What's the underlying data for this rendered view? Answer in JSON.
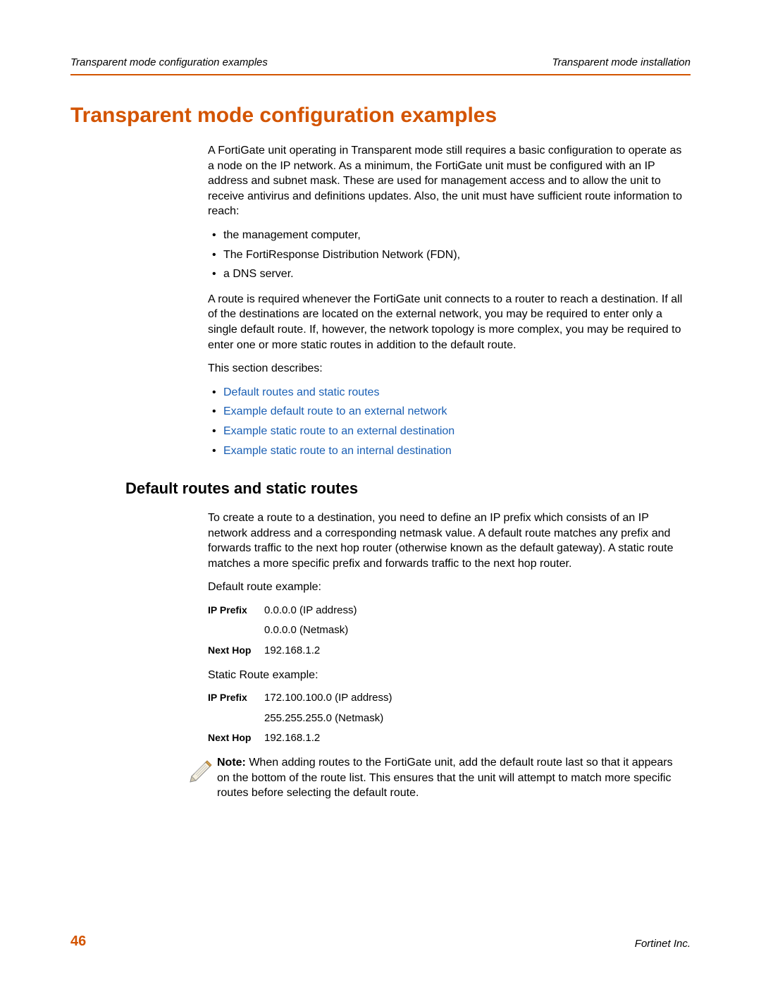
{
  "header": {
    "left": "Transparent mode configuration examples",
    "right": "Transparent mode installation"
  },
  "h1": "Transparent mode configuration examples",
  "intro": "A FortiGate unit operating in Transparent mode still requires a basic configuration to operate as a node on the IP network. As a minimum, the FortiGate unit must be configured with an IP address and subnet mask. These are used for management access and to allow the unit to receive antivirus and definitions updates. Also, the unit must have sufficient route information to reach:",
  "reach_list": [
    "the management computer,",
    "The FortiResponse Distribution Network (FDN),",
    "a DNS server."
  ],
  "route_required": "A route is required whenever the FortiGate unit connects to a router to reach a destination. If all of the destinations are located on the external network, you may be required to enter only a single default route. If, however, the network topology is more complex, you may be required to enter one or more static routes in addition to the default route.",
  "section_describes": "This section describes:",
  "toc_links": [
    "Default routes and static routes",
    "Example default route to an external network",
    "Example static route to an external destination",
    "Example static route to an internal destination"
  ],
  "h2": "Default routes and static routes",
  "default_intro": "To create a route to a destination, you need to define an IP prefix which consists of an IP network address and a corresponding netmask value. A default route matches any prefix and forwards traffic to the next hop router (otherwise known as the default gateway). A static route matches a more specific prefix and forwards traffic to the next hop router.",
  "default_example_label": "Default route example:",
  "default_example": {
    "ip_prefix_label": "IP Prefix",
    "ip_address": "0.0.0.0 (IP address)",
    "netmask": "0.0.0.0 (Netmask)",
    "next_hop_label": "Next Hop",
    "next_hop": "192.168.1.2"
  },
  "static_example_label": "Static Route example:",
  "static_example": {
    "ip_prefix_label": "IP Prefix",
    "ip_address": "172.100.100.0 (IP address)",
    "netmask": "255.255.255.0 (Netmask)",
    "next_hop_label": "Next Hop",
    "next_hop": "192.168.1.2"
  },
  "note_prefix": "Note: ",
  "note_body": "When adding routes to the FortiGate unit, add the default route last so that it appears on the bottom of the route list. This ensures that the unit will attempt to match more specific routes before selecting the default route.",
  "footer": {
    "page_number": "46",
    "company": "Fortinet Inc."
  }
}
